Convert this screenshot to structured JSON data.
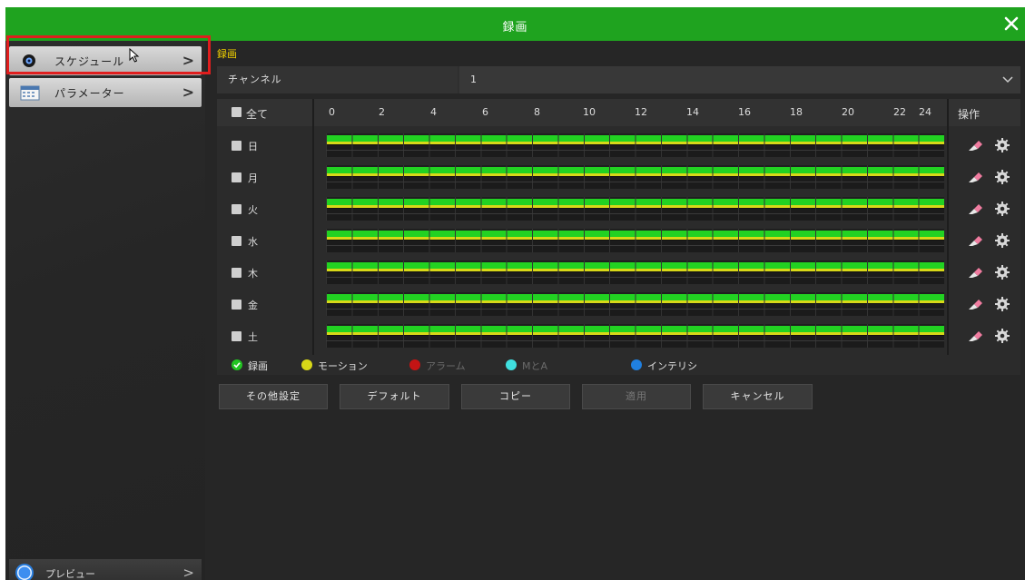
{
  "window": {
    "title": "録画"
  },
  "sidebar": {
    "items": [
      {
        "label": "スケジュール",
        "icon": "camera-icon",
        "chevron": ">"
      },
      {
        "label": "パラメーター",
        "icon": "calendar-icon",
        "chevron": ">"
      }
    ],
    "preview": {
      "label": "プレビュー",
      "chevron": ">"
    }
  },
  "main": {
    "breadcrumb": "録画",
    "channel": {
      "label": "チャンネル",
      "value": "1"
    },
    "grid": {
      "all_label": "全て",
      "operation_label": "操作",
      "hours": [
        "0",
        "2",
        "4",
        "6",
        "8",
        "10",
        "12",
        "14",
        "16",
        "18",
        "20",
        "22",
        "24"
      ],
      "days": [
        "日",
        "月",
        "火",
        "水",
        "木",
        "金",
        "土"
      ]
    },
    "legend": [
      {
        "label": "録画",
        "color": "#22c422"
      },
      {
        "label": "モーション",
        "color": "#d8d818"
      },
      {
        "label": "アラーム",
        "color": "#d81818"
      },
      {
        "label": "MとA",
        "color": "#40e0e0"
      },
      {
        "label": "インテリシ",
        "color": "#2080e0"
      }
    ],
    "buttons": [
      {
        "label": "その他設定",
        "enabled": true
      },
      {
        "label": "デフォルト",
        "enabled": true
      },
      {
        "label": "コピー",
        "enabled": true
      },
      {
        "label": "適用",
        "enabled": false
      },
      {
        "label": "キャンセル",
        "enabled": true
      }
    ]
  },
  "colors": {
    "title_bar": "#1fa31f",
    "accent_text": "#f0d000",
    "record": "#22d222",
    "motion": "#d8d818"
  }
}
